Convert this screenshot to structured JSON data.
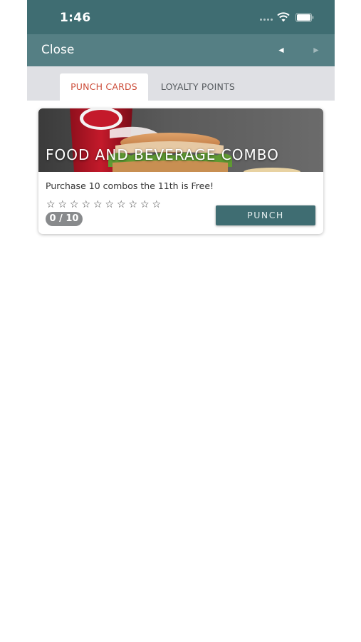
{
  "status_bar": {
    "time": "1:46"
  },
  "nav_bar": {
    "close_label": "Close",
    "prev_arrow": "◄",
    "next_arrow": "►"
  },
  "tabs": [
    {
      "label": "PUNCH CARDS",
      "active": true
    },
    {
      "label": "LOYALTY POINTS",
      "active": false
    }
  ],
  "punch_card": {
    "title": "FOOD AND BEVERAGE COMBO",
    "description": "Purchase 10 combos the 11th is Free!",
    "stars_total": 10,
    "stars_filled": 0,
    "progress_text": "0 / 10",
    "punch_label": "PUNCH"
  },
  "colors": {
    "header": "#3f6d72",
    "nav": "#557f84",
    "tabs_bg": "#dfe0e4",
    "active_tab_text": "#cc4d3a",
    "button": "#3f6d72"
  }
}
